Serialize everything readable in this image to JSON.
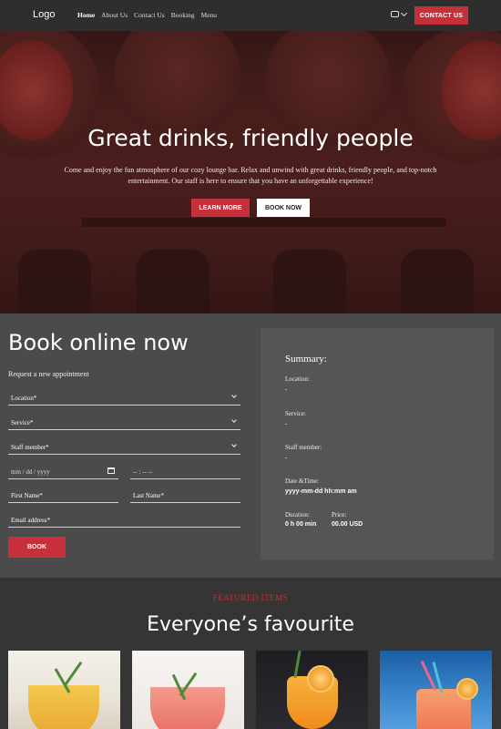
{
  "header": {
    "logo": "Logo",
    "nav": [
      "Home",
      "About Us",
      "Contact Us",
      "Booking",
      "Menu"
    ],
    "contact_label": "CONTACT US",
    "language_icon": "flag-icon"
  },
  "hero": {
    "title": "Great drinks, friendly people",
    "text": "Come and enjoy the fun atmosphere of our cozy lounge bar. Relax and unwind with great drinks, friendly people, and top-notch entertainment. Our staff is here to ensure that you have an unforgettable experience!",
    "learn_more": "LEARN MORE",
    "book_now": "BOOK NOW"
  },
  "booking": {
    "title": "Book online now",
    "subtitle": "Request a new appointment",
    "location": "Location*",
    "service": "Service*",
    "staff": "Staff member*",
    "date_placeholder": "mm / dd / yyyy",
    "time_placeholder": "-- : -- --",
    "first_name": "First Name*",
    "last_name": "Last Name*",
    "email": "Email address*",
    "submit": "BOOK"
  },
  "summary": {
    "title": "Summary:",
    "location_label": "Location:",
    "location_value": "-",
    "service_label": "Service:",
    "service_value": "-",
    "staff_label": "Staff member:",
    "staff_value": "-",
    "datetime_label": "Date &Time:",
    "datetime_value": "yyyy-mm-dd  hh:mm am",
    "duration_label": "Duration:",
    "duration_value": "0 h 00 min",
    "price_label": "Price:",
    "price_value": "00.00 USD"
  },
  "featured": {
    "kicker": "FEATURED ITEMS",
    "title": "Everyone’s favourite"
  },
  "colors": {
    "accent": "#c5303a",
    "header_bg": "#2e2e2e",
    "booking_bg": "#4b4b4b",
    "summary_bg": "#555555",
    "featured_bg": "#353535"
  }
}
